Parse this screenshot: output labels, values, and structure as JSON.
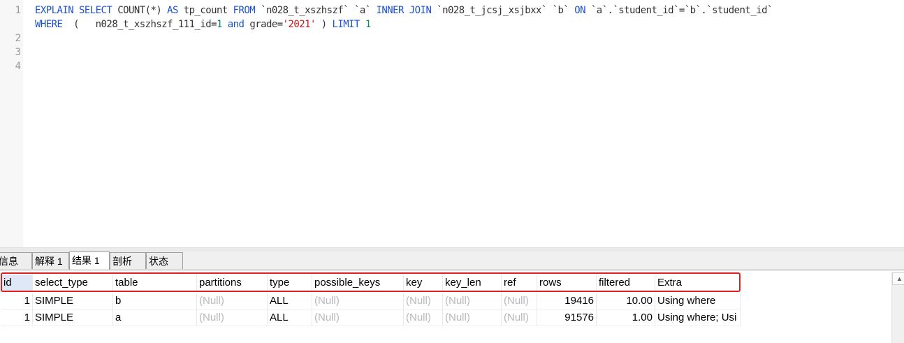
{
  "editor": {
    "line_numbers": [
      "1",
      "2",
      "3",
      "4"
    ],
    "line1": {
      "t1": "EXPLAIN SELECT",
      "t2": " COUNT(*) ",
      "t3": "AS",
      "t4": " tp_count ",
      "t5": "FROM",
      "t6": " `n028_t_xszhszf` `a` ",
      "t7": "INNER JOIN",
      "t8": " `n028_t_jcsj_xsjbxx` `b` ",
      "t9": "ON",
      "t10": " `a`.`student_id`=`b`.`student_id`"
    },
    "line1b": {
      "t1": "WHERE",
      "t2": "  (   n028_t_xszhszf_111_id=",
      "t3": "1",
      "t4": " ",
      "t5": "and",
      "t6": " grade=",
      "t7": "'2021'",
      "t8": " ) ",
      "t9": "LIMIT",
      "t10": " ",
      "t11": "1"
    }
  },
  "tabs": [
    {
      "label": "信息"
    },
    {
      "label": "解释 1"
    },
    {
      "label": "结果 1"
    },
    {
      "label": "剖析"
    },
    {
      "label": "状态"
    }
  ],
  "active_tab": "结果 1",
  "table": {
    "columns": [
      "id",
      "select_type",
      "table",
      "partitions",
      "type",
      "possible_keys",
      "key",
      "key_len",
      "ref",
      "rows",
      "filtered",
      "Extra"
    ],
    "rows": [
      [
        "1",
        "SIMPLE",
        "b",
        "(Null)",
        "ALL",
        "(Null)",
        "(Null)",
        "(Null)",
        "(Null)",
        "19416",
        "10.00",
        "Using where"
      ],
      [
        "1",
        "SIMPLE",
        "a",
        "(Null)",
        "ALL",
        "(Null)",
        "(Null)",
        "(Null)",
        "(Null)",
        "91576",
        "1.00",
        "Using where; Usi"
      ]
    ]
  },
  "colors": {
    "keyword": "#1a52d6",
    "number": "#09885a",
    "string": "#c41a16",
    "highlight_border": "#e0201d"
  },
  "icons": {
    "scroll_up": "chevron-up-icon"
  }
}
